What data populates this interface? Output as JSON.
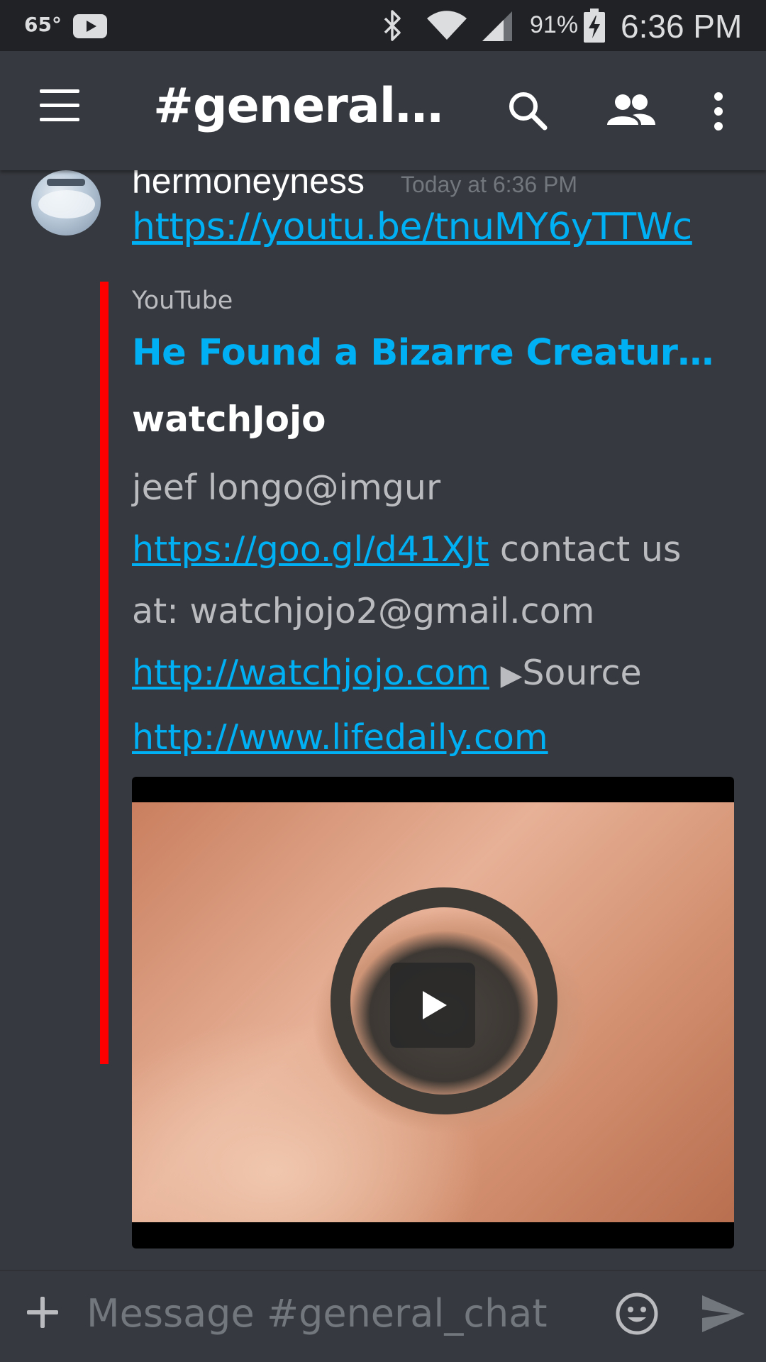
{
  "status_bar": {
    "temperature": "65°",
    "battery_percent": "91%",
    "time": "6:36 PM",
    "icons": [
      "youtube-icon",
      "bluetooth-icon",
      "wifi-icon",
      "cell-signal-icon",
      "battery-charging-icon"
    ]
  },
  "header": {
    "channel": "#general_c...",
    "icons": [
      "menu-icon",
      "search-icon",
      "members-icon",
      "more-vert-icon"
    ]
  },
  "message": {
    "author": "hermoneyness",
    "timestamp": "Today at 6:36 PM",
    "link": "https://youtu.be/tnuMY6yTTWc"
  },
  "embed": {
    "accent_color": "#ff0000",
    "provider": "YouTube",
    "title": "He Found a Bizarre Creature Dy...",
    "author": "watchJojo",
    "desc_text_1": "jeef longo@imgur ",
    "desc_link_1": "https://goo.gl/d41XJt",
    "desc_text_2": " contact us at: watchjojo2@gmail.com ",
    "desc_link_2": "http://watchjojo.com",
    "desc_triangle": "▶",
    "desc_text_3": "Source ",
    "desc_link_3": "http://www.lifedaily.com",
    "video_play_icon": "play-icon"
  },
  "input": {
    "placeholder": "Message #general_chat",
    "icons": [
      "plus-icon",
      "emoji-icon",
      "send-icon"
    ]
  },
  "colors": {
    "background": "#36393f",
    "status_bar": "#202225",
    "link": "#00b0f4",
    "muted_text": "#b9bbbe"
  }
}
